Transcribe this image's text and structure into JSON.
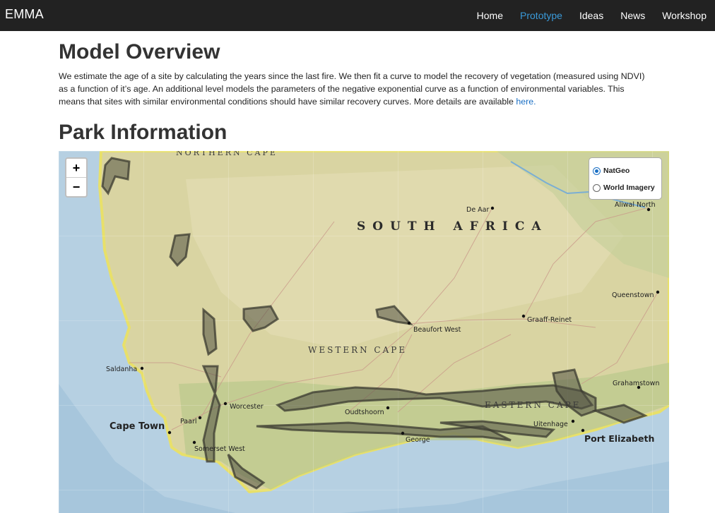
{
  "nav": {
    "brand": "EMMA",
    "items": [
      {
        "label": "Home",
        "active": false
      },
      {
        "label": "Prototype",
        "active": true
      },
      {
        "label": "Ideas",
        "active": false
      },
      {
        "label": "News",
        "active": false
      },
      {
        "label": "Workshop",
        "active": false
      }
    ]
  },
  "overview": {
    "title": "Model Overview",
    "text": "We estimate the age of a site by calculating the years since the last fire. We then fit a curve to model the recovery of vegetation (measured using NDVI) as a function of it’s age. An additional level models the parameters of the negative exponential curve as a function of environmental variables. This means that sites with similar environmental conditions should have similar recovery curves. More details are available ",
    "link": "here."
  },
  "park": {
    "title": "Park Information"
  },
  "map": {
    "zoom_in": "+",
    "zoom_out": "−",
    "layers": [
      {
        "label": "NatGeo",
        "selected": true
      },
      {
        "label": "World Imagery",
        "selected": false
      }
    ],
    "regions": {
      "northern_cape": "NORTHERN CAPE",
      "south_africa": "SOUTH AFRICA",
      "western_cape": "WESTERN CAPE",
      "eastern_cape": "EASTERN CAPE"
    },
    "places": {
      "de_aar": "De Aar",
      "aliwal_north": "Aliwal North",
      "queenstown": "Queenstown",
      "graaff_reinet": "Graaff-Reinet",
      "beaufort_west": "Beaufort West",
      "saldanha": "Saldanha",
      "grahamstown": "Grahamstown",
      "worcester": "Worcester",
      "oudtshoorn": "Oudtshoorn",
      "cape_town": "Cape Town",
      "paarl": "Paarl",
      "uitenhage": "Uitenhage",
      "port_elizabeth": "Port Elizabeth",
      "george": "George",
      "somerset_west": "Somerset West"
    },
    "colors": {
      "land": "#d8d6a4",
      "ocean": "#b9d3e4",
      "park": "#4a4a3a"
    }
  }
}
